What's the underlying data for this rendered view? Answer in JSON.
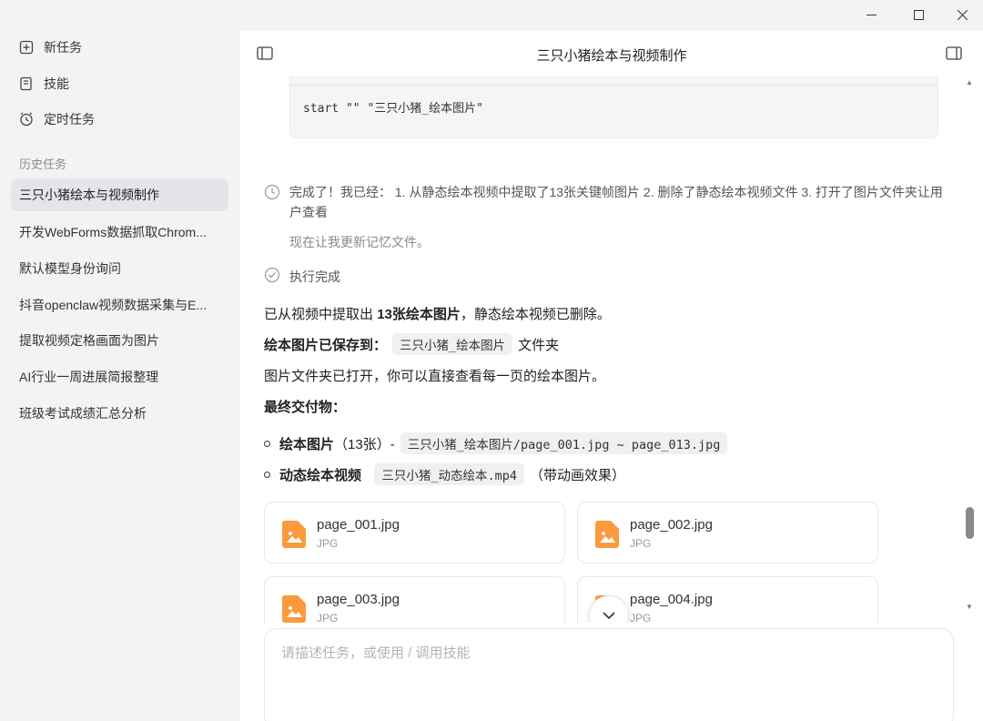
{
  "window": {
    "minimize_label": "—",
    "maximize_label": "☐",
    "close_label": "✕"
  },
  "sidebar": {
    "nav": [
      {
        "label": "新任务",
        "icon": "new-task-icon"
      },
      {
        "label": "技能",
        "icon": "skills-icon"
      },
      {
        "label": "定时任务",
        "icon": "clock-icon"
      }
    ],
    "history_title": "历史任务",
    "history": [
      {
        "label": "三只小猪绘本与视频制作",
        "active": true
      },
      {
        "label": "开发WebForms数据抓取Chrom..."
      },
      {
        "label": "默认模型身份询问"
      },
      {
        "label": "抖音openclaw视频数据采集与E..."
      },
      {
        "label": "提取视频定格画面为图片"
      },
      {
        "label": "AI行业一周进展简报整理"
      },
      {
        "label": "班级考试成绩汇总分析"
      }
    ]
  },
  "main": {
    "title": "三只小猪绘本与视频制作",
    "code_block": {
      "lang": "bash",
      "code": "start \"\" \"三只小猪_绘本图片\""
    },
    "step1": {
      "text": "完成了！我已经： 1. 从静态绘本视频中提取了13张关键帧图片 2. 删除了静态绘本视频文件 3. 打开了图片文件夹让用户查看",
      "sub": "现在让我更新记忆文件。"
    },
    "step2": {
      "text": "执行完成"
    },
    "answer": {
      "line1_pre": "已从视频中提取出",
      "line1_bold": "13张绘本图片",
      "line1_post": "，静态绘本视频已删除。",
      "line2_bold": "绘本图片已保存到：",
      "line2_code": "三只小猪_绘本图片",
      "line2_post": "文件夹",
      "line3": "图片文件夹已打开，你可以直接查看每一页的绘本图片。",
      "line4_bold": "最终交付物：",
      "bullet1_bold": "绘本图片",
      "bullet1_mid": "（13张）-",
      "bullet1_code": "三只小猪_绘本图片/page_001.jpg ~ page_013.jpg",
      "bullet2_bold": "动态绘本视频",
      "bullet2_code": "三只小猪_动态绘本.mp4",
      "bullet2_post": "（带动画效果）"
    },
    "files": [
      {
        "name": "page_001.jpg",
        "type": "JPG"
      },
      {
        "name": "page_002.jpg",
        "type": "JPG"
      },
      {
        "name": "page_003.jpg",
        "type": "JPG"
      },
      {
        "name": "page_004.jpg",
        "type": "JPG"
      }
    ],
    "input_placeholder": "请描述任务，或使用 / 调用技能"
  },
  "colors": {
    "file_icon": "#fb9a3c",
    "sidebar_bg": "#f3f3f3",
    "active_item_bg": "#e4e4ea"
  }
}
